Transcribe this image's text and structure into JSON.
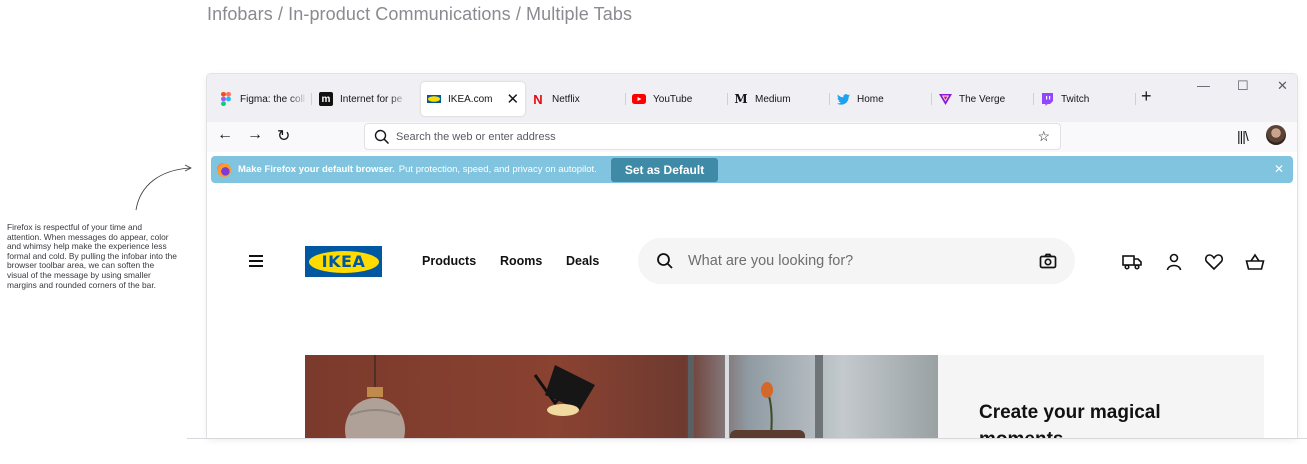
{
  "page": {
    "title": "Infobars / In-product Communications / Multiple Tabs",
    "annotation": "Firefox is respectful of your time and attention. When messages do appear, color and whimsy help make the experience less formal and cold. By pulling the infobar into the browser toolbar area, we can soften the visual of the message by using smaller margins and rounded corners of the bar."
  },
  "tabs": [
    {
      "label": "Figma: the coll",
      "icon": "figma-icon",
      "active": false
    },
    {
      "label": "Internet for pe",
      "icon": "medium-m-icon",
      "active": false
    },
    {
      "label": "IKEA.com",
      "icon": "ikea-favicon",
      "active": true
    },
    {
      "label": "Netflix",
      "icon": "netflix-icon",
      "active": false
    },
    {
      "label": "YouTube",
      "icon": "youtube-icon",
      "active": false
    },
    {
      "label": "Medium",
      "icon": "medium-icon",
      "active": false
    },
    {
      "label": "Home",
      "icon": "twitter-icon",
      "active": false
    },
    {
      "label": "The Verge",
      "icon": "verge-icon",
      "active": false
    },
    {
      "label": "Twitch",
      "icon": "twitch-icon",
      "active": false
    }
  ],
  "toolbar": {
    "url_placeholder": "Search the web or enter address"
  },
  "infobar": {
    "headline": "Make Firefox your default browser.",
    "message": "Put protection, speed, and privacy on autopilot.",
    "button_label": "Set as Default",
    "color": "#80c4e0"
  },
  "ikea": {
    "logo_text": "IKEA",
    "nav": [
      "Products",
      "Rooms",
      "Deals"
    ],
    "search_placeholder": "What are you looking for?",
    "hero_heading": "Create your magical moments"
  }
}
